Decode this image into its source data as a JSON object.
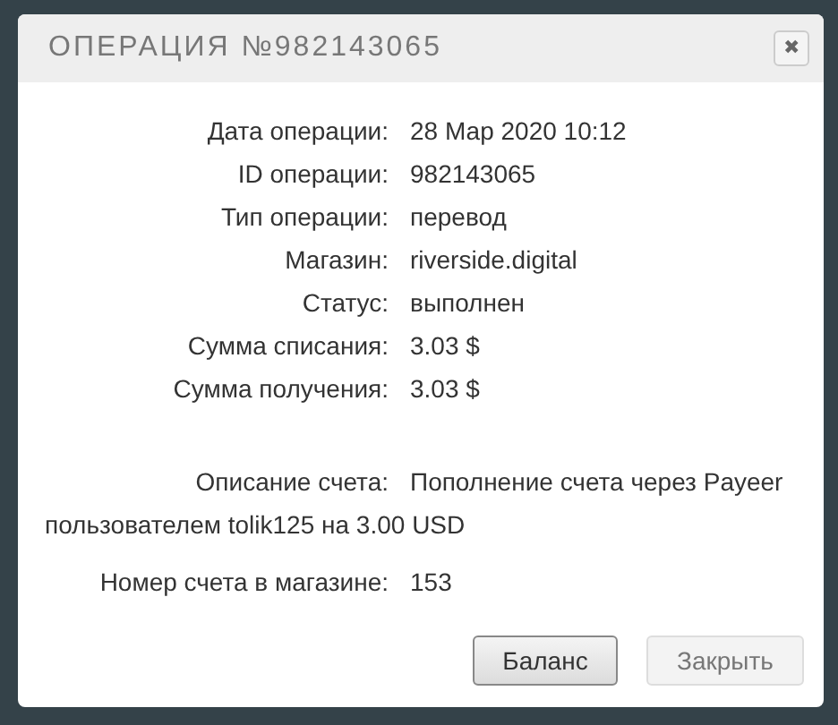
{
  "dialog": {
    "title": "ОПЕРАЦИЯ №982143065",
    "close": "✖"
  },
  "details": [
    {
      "label": "Дата операции:",
      "value": "28 Мар 2020 10:12"
    },
    {
      "label": "ID операции:",
      "value": "982143065"
    },
    {
      "label": "Тип операции:",
      "value": "перевод"
    },
    {
      "label": "Магазин:",
      "value": "riverside.digital"
    },
    {
      "label": "Статус:",
      "value": "выполнен"
    },
    {
      "label": "Сумма списания:",
      "value": "3.03 $"
    },
    {
      "label": "Сумма получения:",
      "value": "3.03 $"
    }
  ],
  "invoice": [
    {
      "label": "Описание счета:",
      "value": "Пополнение счета через Payeer пользователем tolik125 на 3.00 USD"
    },
    {
      "label": "Номер счета в магазине:",
      "value": "153"
    }
  ],
  "buttons": [
    {
      "label": "Баланс",
      "kind": "primary"
    },
    {
      "label": "Закрыть",
      "kind": "secondary"
    }
  ]
}
